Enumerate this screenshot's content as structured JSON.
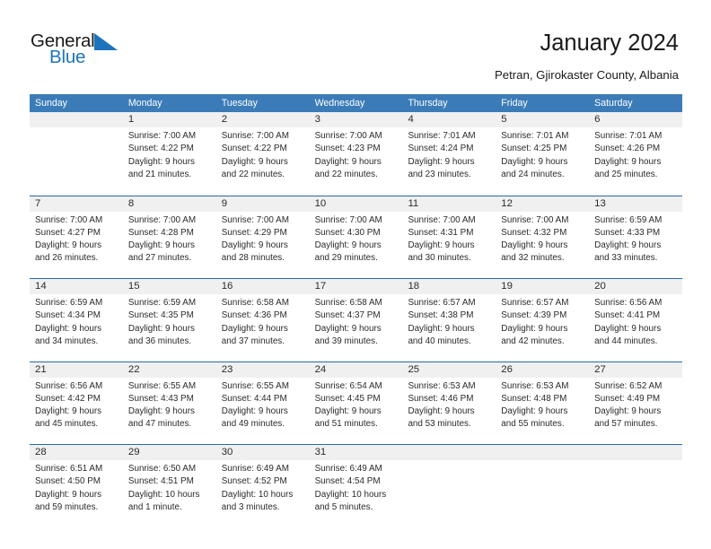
{
  "brand": {
    "name_part1": "General",
    "name_part2": "Blue",
    "flag_icon": "blue-triangle-flag-icon",
    "accent_color": "#1d74bb"
  },
  "header": {
    "title": "January 2024",
    "location": "Petran, Gjirokaster County, Albania"
  },
  "calendar": {
    "header_bg": "#3b7cb8",
    "row_rule_color": "#2a68a8",
    "daynum_band_color": "#f0f0f0",
    "weekdays": [
      "Sunday",
      "Monday",
      "Tuesday",
      "Wednesday",
      "Thursday",
      "Friday",
      "Saturday"
    ],
    "weeks": [
      [
        {
          "day": "",
          "lines": []
        },
        {
          "day": "1",
          "lines": [
            "Sunrise: 7:00 AM",
            "Sunset: 4:22 PM",
            "Daylight: 9 hours",
            "and 21 minutes."
          ]
        },
        {
          "day": "2",
          "lines": [
            "Sunrise: 7:00 AM",
            "Sunset: 4:22 PM",
            "Daylight: 9 hours",
            "and 22 minutes."
          ]
        },
        {
          "day": "3",
          "lines": [
            "Sunrise: 7:00 AM",
            "Sunset: 4:23 PM",
            "Daylight: 9 hours",
            "and 22 minutes."
          ]
        },
        {
          "day": "4",
          "lines": [
            "Sunrise: 7:01 AM",
            "Sunset: 4:24 PM",
            "Daylight: 9 hours",
            "and 23 minutes."
          ]
        },
        {
          "day": "5",
          "lines": [
            "Sunrise: 7:01 AM",
            "Sunset: 4:25 PM",
            "Daylight: 9 hours",
            "and 24 minutes."
          ]
        },
        {
          "day": "6",
          "lines": [
            "Sunrise: 7:01 AM",
            "Sunset: 4:26 PM",
            "Daylight: 9 hours",
            "and 25 minutes."
          ]
        }
      ],
      [
        {
          "day": "7",
          "lines": [
            "Sunrise: 7:00 AM",
            "Sunset: 4:27 PM",
            "Daylight: 9 hours",
            "and 26 minutes."
          ]
        },
        {
          "day": "8",
          "lines": [
            "Sunrise: 7:00 AM",
            "Sunset: 4:28 PM",
            "Daylight: 9 hours",
            "and 27 minutes."
          ]
        },
        {
          "day": "9",
          "lines": [
            "Sunrise: 7:00 AM",
            "Sunset: 4:29 PM",
            "Daylight: 9 hours",
            "and 28 minutes."
          ]
        },
        {
          "day": "10",
          "lines": [
            "Sunrise: 7:00 AM",
            "Sunset: 4:30 PM",
            "Daylight: 9 hours",
            "and 29 minutes."
          ]
        },
        {
          "day": "11",
          "lines": [
            "Sunrise: 7:00 AM",
            "Sunset: 4:31 PM",
            "Daylight: 9 hours",
            "and 30 minutes."
          ]
        },
        {
          "day": "12",
          "lines": [
            "Sunrise: 7:00 AM",
            "Sunset: 4:32 PM",
            "Daylight: 9 hours",
            "and 32 minutes."
          ]
        },
        {
          "day": "13",
          "lines": [
            "Sunrise: 6:59 AM",
            "Sunset: 4:33 PM",
            "Daylight: 9 hours",
            "and 33 minutes."
          ]
        }
      ],
      [
        {
          "day": "14",
          "lines": [
            "Sunrise: 6:59 AM",
            "Sunset: 4:34 PM",
            "Daylight: 9 hours",
            "and 34 minutes."
          ]
        },
        {
          "day": "15",
          "lines": [
            "Sunrise: 6:59 AM",
            "Sunset: 4:35 PM",
            "Daylight: 9 hours",
            "and 36 minutes."
          ]
        },
        {
          "day": "16",
          "lines": [
            "Sunrise: 6:58 AM",
            "Sunset: 4:36 PM",
            "Daylight: 9 hours",
            "and 37 minutes."
          ]
        },
        {
          "day": "17",
          "lines": [
            "Sunrise: 6:58 AM",
            "Sunset: 4:37 PM",
            "Daylight: 9 hours",
            "and 39 minutes."
          ]
        },
        {
          "day": "18",
          "lines": [
            "Sunrise: 6:57 AM",
            "Sunset: 4:38 PM",
            "Daylight: 9 hours",
            "and 40 minutes."
          ]
        },
        {
          "day": "19",
          "lines": [
            "Sunrise: 6:57 AM",
            "Sunset: 4:39 PM",
            "Daylight: 9 hours",
            "and 42 minutes."
          ]
        },
        {
          "day": "20",
          "lines": [
            "Sunrise: 6:56 AM",
            "Sunset: 4:41 PM",
            "Daylight: 9 hours",
            "and 44 minutes."
          ]
        }
      ],
      [
        {
          "day": "21",
          "lines": [
            "Sunrise: 6:56 AM",
            "Sunset: 4:42 PM",
            "Daylight: 9 hours",
            "and 45 minutes."
          ]
        },
        {
          "day": "22",
          "lines": [
            "Sunrise: 6:55 AM",
            "Sunset: 4:43 PM",
            "Daylight: 9 hours",
            "and 47 minutes."
          ]
        },
        {
          "day": "23",
          "lines": [
            "Sunrise: 6:55 AM",
            "Sunset: 4:44 PM",
            "Daylight: 9 hours",
            "and 49 minutes."
          ]
        },
        {
          "day": "24",
          "lines": [
            "Sunrise: 6:54 AM",
            "Sunset: 4:45 PM",
            "Daylight: 9 hours",
            "and 51 minutes."
          ]
        },
        {
          "day": "25",
          "lines": [
            "Sunrise: 6:53 AM",
            "Sunset: 4:46 PM",
            "Daylight: 9 hours",
            "and 53 minutes."
          ]
        },
        {
          "day": "26",
          "lines": [
            "Sunrise: 6:53 AM",
            "Sunset: 4:48 PM",
            "Daylight: 9 hours",
            "and 55 minutes."
          ]
        },
        {
          "day": "27",
          "lines": [
            "Sunrise: 6:52 AM",
            "Sunset: 4:49 PM",
            "Daylight: 9 hours",
            "and 57 minutes."
          ]
        }
      ],
      [
        {
          "day": "28",
          "lines": [
            "Sunrise: 6:51 AM",
            "Sunset: 4:50 PM",
            "Daylight: 9 hours",
            "and 59 minutes."
          ]
        },
        {
          "day": "29",
          "lines": [
            "Sunrise: 6:50 AM",
            "Sunset: 4:51 PM",
            "Daylight: 10 hours",
            "and 1 minute."
          ]
        },
        {
          "day": "30",
          "lines": [
            "Sunrise: 6:49 AM",
            "Sunset: 4:52 PM",
            "Daylight: 10 hours",
            "and 3 minutes."
          ]
        },
        {
          "day": "31",
          "lines": [
            "Sunrise: 6:49 AM",
            "Sunset: 4:54 PM",
            "Daylight: 10 hours",
            "and 5 minutes."
          ]
        },
        {
          "day": "",
          "lines": []
        },
        {
          "day": "",
          "lines": []
        },
        {
          "day": "",
          "lines": []
        }
      ]
    ]
  }
}
